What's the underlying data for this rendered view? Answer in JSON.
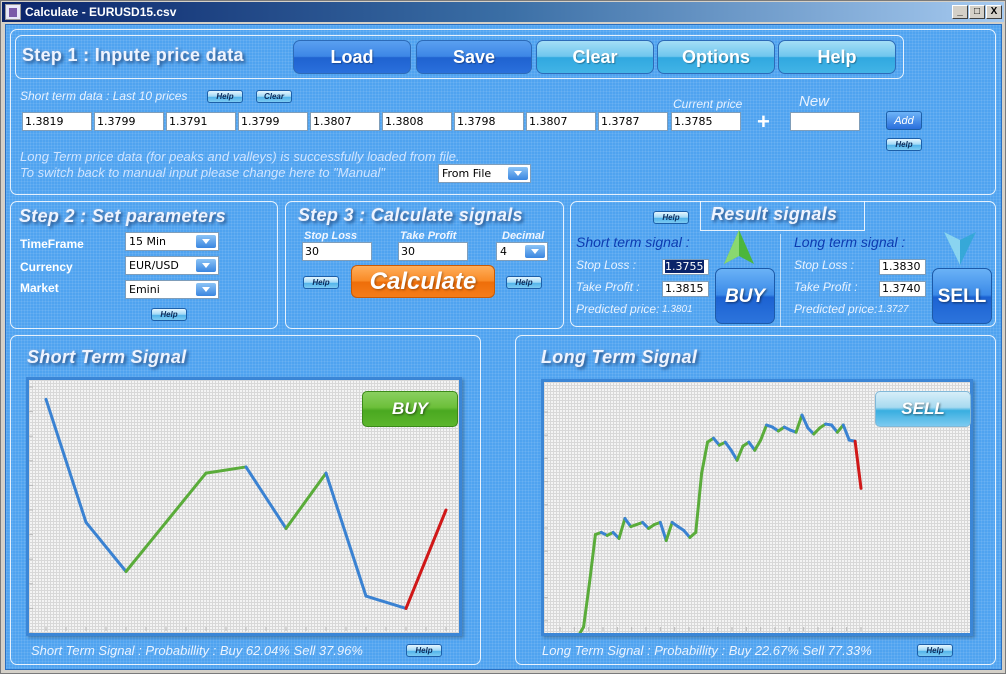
{
  "window": {
    "title": "Calculate - EURUSD15.csv",
    "controls": {
      "minimize": "_",
      "maximize": "□",
      "close": "X"
    }
  },
  "step1": {
    "title": "Step 1 : Inpute price data",
    "buttons": {
      "load": "Load",
      "save": "Save",
      "clear": "Clear",
      "options": "Options",
      "help": "Help"
    },
    "short_term_label": "Short term data : Last 10 prices",
    "help_label": "Help",
    "clear_label": "Clear",
    "current_price_label": "Current price",
    "new_label": "New",
    "plus_icon": "+",
    "prices": [
      "1.3819",
      "1.3799",
      "1.3791",
      "1.3799",
      "1.3807",
      "1.3808",
      "1.3798",
      "1.3807",
      "1.3787"
    ],
    "current_price": "1.3785",
    "new_value": "",
    "add_label": "Add",
    "add_help_label": "Help",
    "long_term_msg1": "Long Term price data (for peaks and valleys) is successfully loaded from file.",
    "long_term_msg2": "To switch back to manual input please change here to \"Manual\"",
    "source_select": "From File"
  },
  "step2": {
    "title": "Step 2 : Set parameters",
    "timeframe_label": "TimeFrame",
    "timeframe": "15 Min",
    "currency_label": "Currency",
    "currency": "EUR/USD",
    "market_label": "Market",
    "market": "Emini",
    "help_label": "Help"
  },
  "step3": {
    "title": "Step 3 : Calculate signals",
    "stop_loss_label": "Stop Loss",
    "stop_loss": "30",
    "take_profit_label": "Take Profit",
    "take_profit": "30",
    "decimal_label": "Decimal",
    "decimal": "4",
    "calculate_label": "Calculate",
    "help_left": "Help",
    "help_right": "Help"
  },
  "result": {
    "title": "Result signals",
    "help_label": "Help",
    "short": {
      "heading": "Short term signal :",
      "stop_loss_label": "Stop Loss :",
      "stop_loss": "1.3755",
      "take_profit_label": "Take Profit :",
      "take_profit": "1.3815",
      "predicted_label": "Predicted price:",
      "predicted": "1.3801",
      "action": "BUY"
    },
    "long": {
      "heading": "Long term signal :",
      "stop_loss_label": "Stop Loss :",
      "stop_loss": "1.3830",
      "take_profit_label": "Take Profit :",
      "take_profit": "1.3740",
      "predicted_label": "Predicted price:",
      "predicted": "1.3727",
      "action": "SELL"
    }
  },
  "short_panel": {
    "title": "Short Term Signal",
    "badge": "BUY",
    "probability_label": "Short Term Signal : Probabillity :",
    "probability_values": "Buy 62.04% Sell 37.96%",
    "help_label": "Help"
  },
  "long_panel": {
    "title": "Long Term Signal",
    "badge": "SELL",
    "probability_label": "Long Term Signal : Probabillity :",
    "probability_values": "Buy 22.67% Sell 77.33%",
    "help_label": "Help"
  },
  "colors": {
    "up": "#5aac3a",
    "down": "#3a82d2",
    "forecast": "#d01818",
    "background": "#4fa3f0"
  },
  "chart_data": [
    {
      "type": "line",
      "title": "Short Term Signal",
      "xlabel": "",
      "ylabel": "",
      "x": [
        1,
        2,
        3,
        4,
        5,
        6,
        7,
        8,
        9,
        10
      ],
      "values": [
        1.3819,
        1.3799,
        1.3791,
        1.3799,
        1.3807,
        1.3808,
        1.3798,
        1.3807,
        1.3787,
        1.3785
      ],
      "forecast": {
        "x": 11,
        "value": 1.3801
      },
      "ylim": [
        1.3781,
        1.3821
      ],
      "xlim": [
        1,
        11
      ],
      "grid": true,
      "note": "segment colors: green = rising, blue = falling, red = forecast"
    },
    {
      "type": "line",
      "title": "Long Term Signal",
      "xlabel": "",
      "ylabel": "",
      "units": "relative level (0 = lowest, 100 = highest shown)",
      "values": [
        0.4,
        2.6,
        0.4,
        3.0,
        7.4,
        26.4,
        47.2,
        48.1,
        46.8,
        48.1,
        45.5,
        54.1,
        50.6,
        51.5,
        52.4,
        49.8,
        51.5,
        52.4,
        44.6,
        52.4,
        50.6,
        48.9,
        45.9,
        48.1,
        73.6,
        87.0,
        88.7,
        85.7,
        87.0,
        83.5,
        79.2,
        85.3,
        87.0,
        83.5,
        87.9,
        94.4,
        93.5,
        91.8,
        93.5,
        92.2,
        91.3,
        98.7,
        93.1,
        90.5,
        93.1,
        94.8,
        94.4,
        91.3,
        94.4,
        87.9,
        87.4
      ],
      "forecast": {
        "value": 67.1
      },
      "ylim": [
        0,
        100
      ],
      "grid": true,
      "note": "segment colors: green = rising, blue = falling, red = forecast"
    }
  ]
}
